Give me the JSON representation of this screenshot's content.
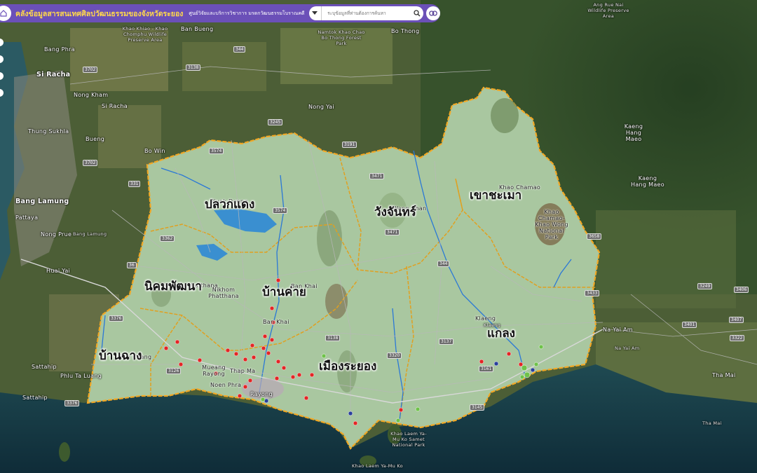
{
  "header": {
    "title": "คลังข้อมูลสารสนเทศศิลปวัฒนธรรมของจังหวัดระยอง",
    "org": "ศูนย์วิจัยและบริการวิชาการ มรดกวัฒนธรรมโบราณคดี",
    "search_placeholder": "ระบุข้อมูลที่ท่านต้องการค้นหา",
    "home_icon": "home-icon",
    "dropdown_icon": "caret-down-icon",
    "search_icon": "search-icon",
    "link_icon": "link-icon"
  },
  "districts": [
    "ปลวกแดง",
    "วังจันทร์",
    "เขาชะเมา",
    "นิคมพัฒนา",
    "บ้านค่าย",
    "บ้านฉาง",
    "เมืองระยอง",
    "แกลง"
  ],
  "place_labels": [
    "Si Racha",
    "Bang Phra",
    "Nong Kham",
    "Si Racha",
    "Thung Sukhla",
    "Bueng",
    "Bo Win",
    "Bang Lamung",
    "Pattaya",
    "Nong Prue",
    "Bang Lamung",
    "Huai Yai",
    "Sattahip",
    "Phlu Ta Luang",
    "Sattahip",
    "Ban Bueng",
    "Khao Khiao - Khao Chomphu Wildlife Preserve Area",
    "Namtok Khao Chao Bo Thong Forest Park",
    "Bo Thong",
    "Nong Yai",
    "Ang Rue Nai Wildlife Preserve Area",
    "Kaeng Hang Maeo",
    "Kaeng Hang Maeo",
    "Pluak Daeng",
    "Wang Chan",
    "Khao Chamao",
    "Khao Chamao-Khao Wong National Park",
    "Nikhom Phatthana",
    "Nikhom Phatthana",
    "Ban Khai",
    "Ban Khai",
    "Ban Chang",
    "Mueang Rayong",
    "Thap Ma",
    "Noen Phra",
    "Rayong",
    "Klaeng",
    "Klaeng",
    "Na Yai Am",
    "Na Yai Am",
    "Tha Mai",
    "Tha Mai",
    "Khao Laem Ya-Mu Ko Samet National Park",
    "Khao Laem Ya-Mu Ko"
  ],
  "road_numbers": [
    "344",
    "3138",
    "3702",
    "3245",
    "3574",
    "331",
    "3376",
    "36",
    "3401",
    "3471",
    "344",
    "3433",
    "3249",
    "3406",
    "3407",
    "3322",
    "3137",
    "3138",
    "3320",
    "3161",
    "3145",
    "3658",
    "3702",
    "3191",
    "3376",
    "3126",
    "3362",
    "3574",
    "3471"
  ]
}
